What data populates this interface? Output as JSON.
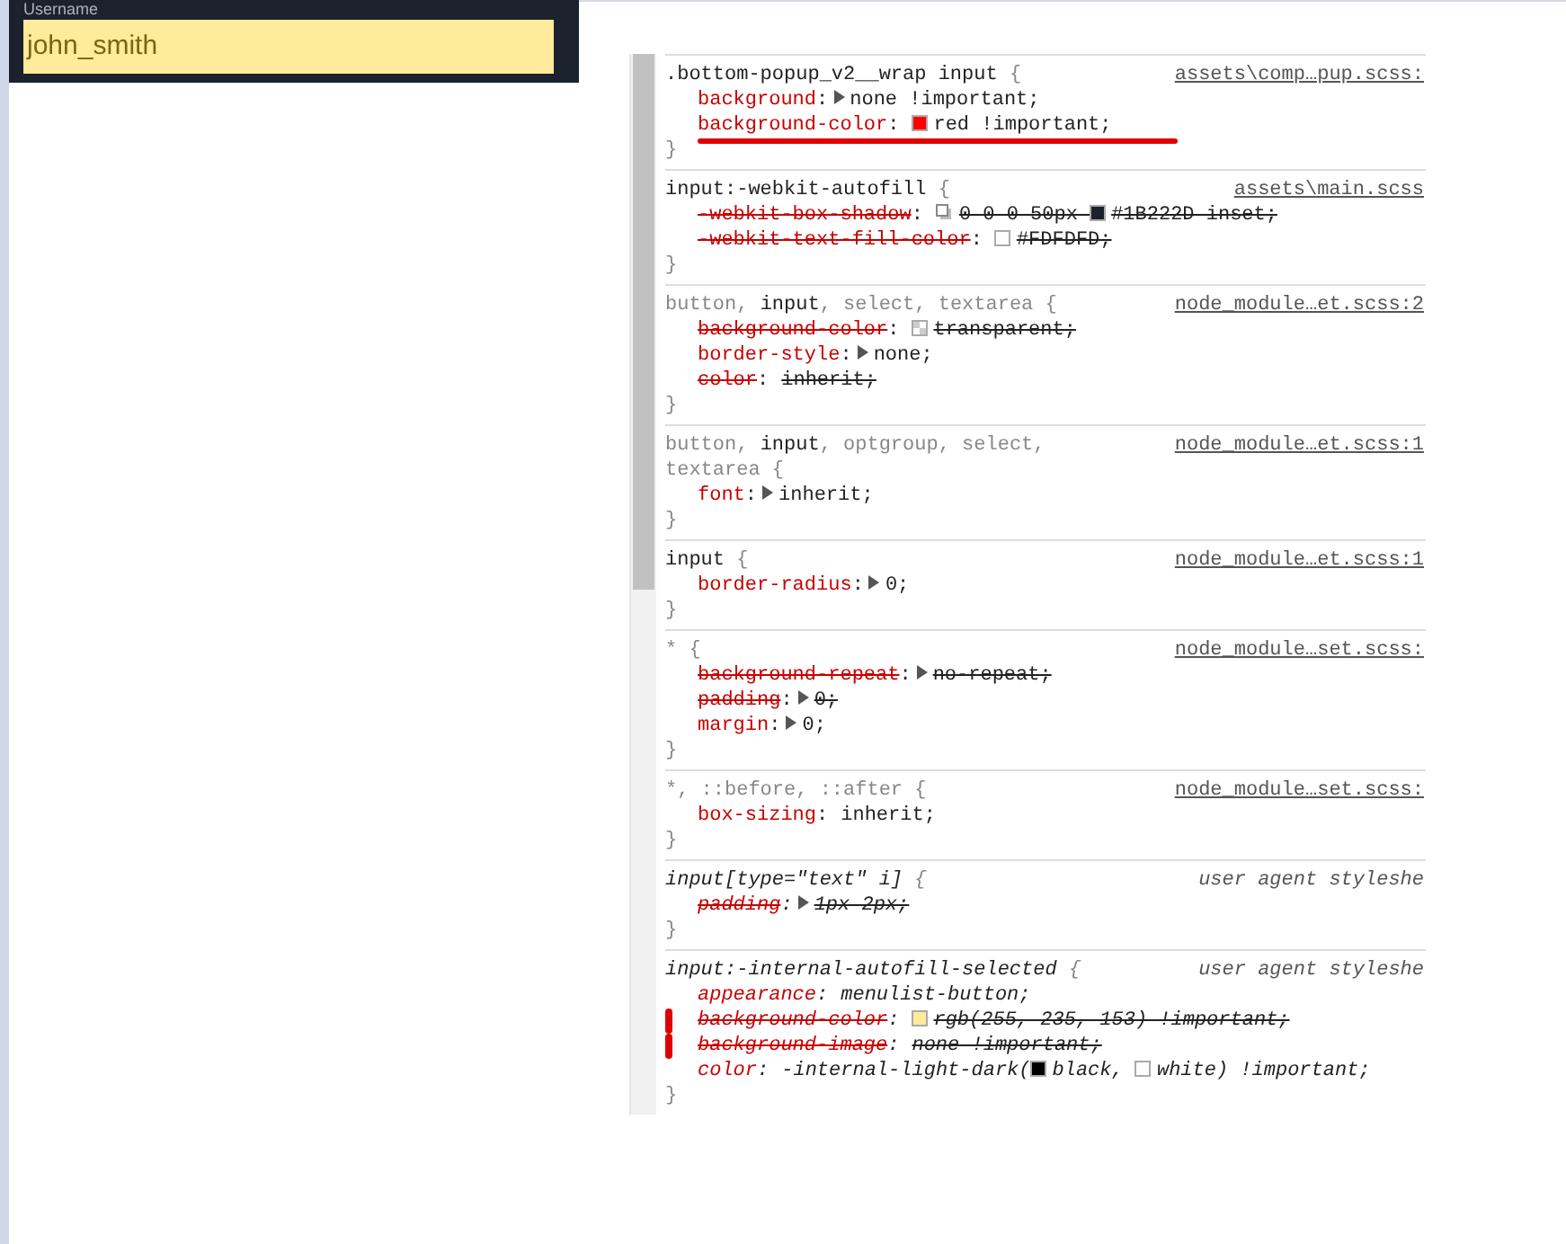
{
  "login": {
    "label": "Username",
    "value": "john_smith"
  },
  "rules": [
    {
      "selector": [
        {
          "text": ".bottom-popup_v2__wrap input",
          "matched": true
        },
        {
          "text": " {",
          "matched": false
        }
      ],
      "source": "assets\\comp…pup.scss:",
      "italic": false,
      "close": "}",
      "declarations": [
        {
          "property": "background",
          "colon": ":",
          "struck": false,
          "expander": true,
          "value": [
            {
              "kind": "text",
              "text": "none !important;"
            }
          ]
        },
        {
          "property": "background-color",
          "colon": ":",
          "struck": false,
          "expander": false,
          "underlined": true,
          "value": [
            {
              "kind": "swatch",
              "color": "#ff0000"
            },
            {
              "kind": "text",
              "text": "red !important;"
            }
          ]
        }
      ]
    },
    {
      "selector": [
        {
          "text": "input:-webkit-autofill",
          "matched": true
        },
        {
          "text": " {",
          "matched": false
        }
      ],
      "source": "assets\\main.scss",
      "italic": false,
      "close": "}",
      "declarations": [
        {
          "property": "-webkit-box-shadow",
          "colon": ":",
          "struck": true,
          "expander": false,
          "value": [
            {
              "kind": "shadow"
            },
            {
              "kind": "text",
              "text": "0 0 0 50px "
            },
            {
              "kind": "swatch",
              "color": "#1b222d"
            },
            {
              "kind": "text",
              "text": "#1B222D inset;"
            }
          ]
        },
        {
          "property": "-webkit-text-fill-color",
          "colon": ":",
          "struck": true,
          "expander": false,
          "value": [
            {
              "kind": "swatch",
              "color": "#fdfdfd"
            },
            {
              "kind": "text",
              "text": "#FDFDFD;"
            }
          ]
        }
      ]
    },
    {
      "selector": [
        {
          "text": "button, ",
          "matched": false
        },
        {
          "text": "input",
          "matched": true
        },
        {
          "text": ", select, textarea {",
          "matched": false
        }
      ],
      "source": "node_module…et.scss:2",
      "italic": false,
      "close": "}",
      "declarations": [
        {
          "property": "background-color",
          "colon": ":",
          "struck": true,
          "expander": false,
          "value": [
            {
              "kind": "checker"
            },
            {
              "kind": "text",
              "text": "transparent;"
            }
          ]
        },
        {
          "property": "border-style",
          "colon": ":",
          "struck": false,
          "expander": true,
          "value": [
            {
              "kind": "text",
              "text": "none;"
            }
          ]
        },
        {
          "property": "color",
          "colon": ":",
          "struck": true,
          "expander": false,
          "value": [
            {
              "kind": "text",
              "text": "inherit;"
            }
          ]
        }
      ]
    },
    {
      "selector": [
        {
          "text": "button, ",
          "matched": false
        },
        {
          "text": "input",
          "matched": true
        },
        {
          "text": ", optgroup, select,",
          "matched": false
        },
        {
          "text": "textarea {",
          "matched": false,
          "newline": true
        }
      ],
      "source": "node_module…et.scss:1",
      "italic": false,
      "close": "}",
      "declarations": [
        {
          "property": "font",
          "colon": ":",
          "struck": false,
          "expander": true,
          "value": [
            {
              "kind": "text",
              "text": "inherit;"
            }
          ]
        }
      ]
    },
    {
      "selector": [
        {
          "text": "input",
          "matched": true
        },
        {
          "text": " {",
          "matched": false
        }
      ],
      "source": "node_module…et.scss:1",
      "italic": false,
      "close": "}",
      "declarations": [
        {
          "property": "border-radius",
          "colon": ":",
          "struck": false,
          "expander": true,
          "value": [
            {
              "kind": "text",
              "text": "0;"
            }
          ]
        }
      ]
    },
    {
      "selector": [
        {
          "text": "* {",
          "matched": false
        }
      ],
      "source": "node_module…set.scss:",
      "italic": false,
      "close": "}",
      "declarations": [
        {
          "property": "background-repeat",
          "colon": ":",
          "struck": true,
          "expander": true,
          "value": [
            {
              "kind": "text",
              "text": "no-repeat;"
            }
          ]
        },
        {
          "property": "padding",
          "colon": ":",
          "struck": true,
          "expander": true,
          "value": [
            {
              "kind": "text",
              "text": "0;"
            }
          ]
        },
        {
          "property": "margin",
          "colon": ":",
          "struck": false,
          "expander": true,
          "value": [
            {
              "kind": "text",
              "text": "0;"
            }
          ]
        }
      ]
    },
    {
      "selector": [
        {
          "text": "*, ::before, ::after {",
          "matched": false
        }
      ],
      "source": "node_module…set.scss:",
      "italic": false,
      "close": "}",
      "declarations": [
        {
          "property": "box-sizing",
          "colon": ":",
          "struck": false,
          "expander": false,
          "value": [
            {
              "kind": "text",
              "text": "inherit;"
            }
          ]
        }
      ]
    },
    {
      "selector": [
        {
          "text": "input[type=\"text\" i]",
          "matched": true
        },
        {
          "text": " {",
          "matched": false
        }
      ],
      "source": "user agent styleshe",
      "italic": true,
      "close": "}",
      "declarations": [
        {
          "property": "padding",
          "colon": ":",
          "struck": true,
          "expander": true,
          "value": [
            {
              "kind": "text",
              "text": "1px 2px;"
            }
          ]
        }
      ]
    },
    {
      "selector": [
        {
          "text": "input:-internal-autofill-selected",
          "matched": true
        },
        {
          "text": " {",
          "matched": false
        }
      ],
      "source": "user agent styleshe",
      "italic": true,
      "close": "}",
      "declarations": [
        {
          "property": "appearance",
          "colon": ":",
          "struck": false,
          "expander": false,
          "value": [
            {
              "kind": "text",
              "text": "menulist-button;"
            }
          ]
        },
        {
          "property": "background-color",
          "colon": ":",
          "struck": true,
          "expander": false,
          "side_marked": true,
          "value": [
            {
              "kind": "swatch",
              "color": "#ffeb99"
            },
            {
              "kind": "text",
              "text": "rgb(255, 235, 153) !important;"
            }
          ]
        },
        {
          "property": "background-image",
          "colon": ":",
          "struck": true,
          "expander": false,
          "side_marked": true,
          "value": [
            {
              "kind": "text",
              "text": "none !important;"
            }
          ]
        },
        {
          "property": "color",
          "colon": ":",
          "struck": false,
          "expander": false,
          "value": [
            {
              "kind": "text",
              "text": "-internal-light-dark("
            },
            {
              "kind": "swatch",
              "color": "#000000"
            },
            {
              "kind": "text",
              "text": "black, "
            },
            {
              "kind": "swatch",
              "color": "#ffffff"
            },
            {
              "kind": "text",
              "text": "white) !important;"
            }
          ]
        }
      ]
    }
  ]
}
